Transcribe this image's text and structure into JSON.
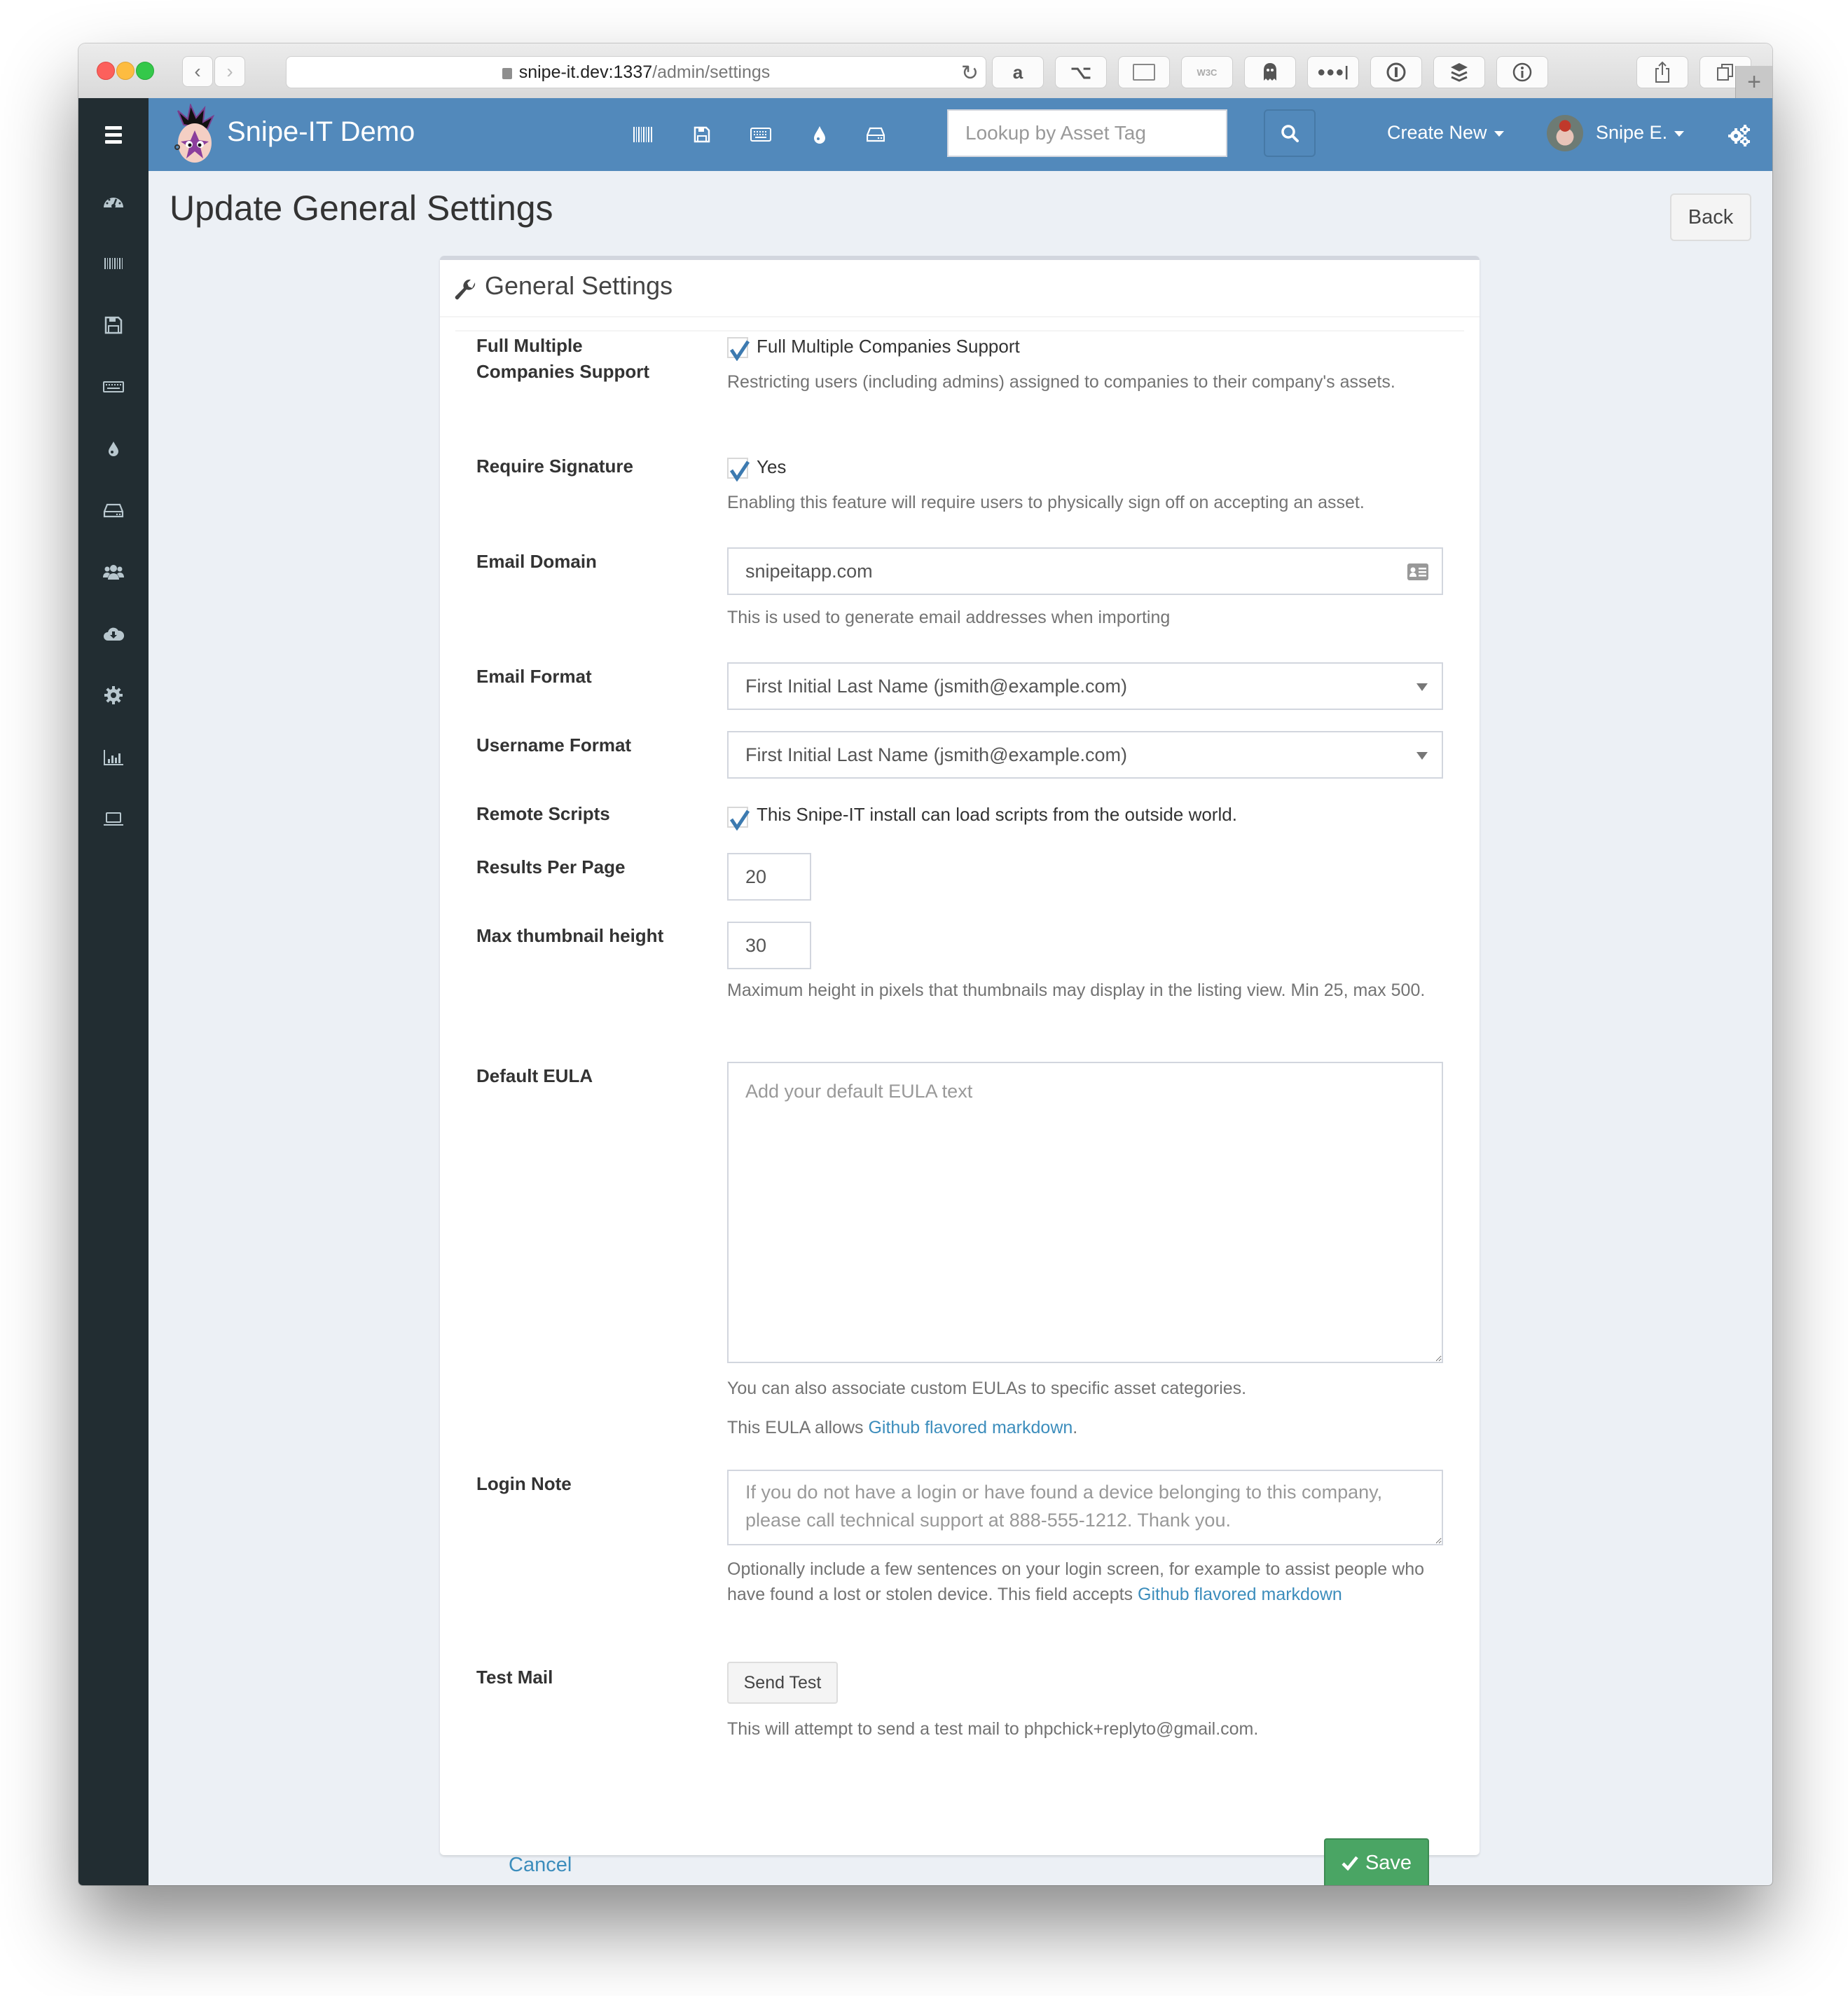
{
  "browser": {
    "url_host": "snipe-it.dev:1337",
    "url_path": "/admin/settings",
    "extensions": [
      "amazon-icon",
      "option-key-icon",
      "reader-icon",
      "w3c-validator-icon",
      "ghostery-icon",
      "lastpass-icon",
      "onepassword-icon",
      "buffer-icon",
      "info-icon"
    ],
    "w3c_label": "W3C"
  },
  "nav": {
    "brand": "Snipe-IT Demo",
    "icons": [
      "barcode-icon",
      "floppy-icon",
      "keyboard-icon",
      "tint-icon",
      "hdd-icon"
    ],
    "lookup_placeholder": "Lookup by Asset Tag",
    "create_new": "Create New",
    "user_name": "Snipe E."
  },
  "sidebar": {
    "items": [
      "dashboard-icon",
      "barcode-icon",
      "floppy-icon",
      "keyboard-icon",
      "tint-icon",
      "hdd-icon",
      "users-icon",
      "cloud-download-icon",
      "cog-icon",
      "bar-chart-icon",
      "laptop-icon"
    ]
  },
  "page": {
    "title": "Update General Settings",
    "back_label": "Back"
  },
  "panel": {
    "title": "General Settings"
  },
  "form": {
    "full_multiple_companies": {
      "label_line1": "Full Multiple",
      "label_line2": "Companies Support",
      "checkbox_label": "Full Multiple Companies Support",
      "checked": true,
      "help": "Restricting users (including admins) assigned to companies to their company's assets."
    },
    "require_signature": {
      "label": "Require Signature",
      "checkbox_label": "Yes",
      "checked": true,
      "help": "Enabling this feature will require users to physically sign off on accepting an asset."
    },
    "email_domain": {
      "label": "Email Domain",
      "value": "snipeitapp.com",
      "help": "This is used to generate email addresses when importing"
    },
    "email_format": {
      "label": "Email Format",
      "selected": "First Initial Last Name (jsmith@example.com)"
    },
    "username_format": {
      "label": "Username Format",
      "selected": "First Initial Last Name (jsmith@example.com)"
    },
    "remote_scripts": {
      "label": "Remote Scripts",
      "checkbox_label": "This Snipe-IT install can load scripts from the outside world.",
      "checked": true
    },
    "results_per_page": {
      "label": "Results Per Page",
      "value": "20"
    },
    "max_thumbnail_height": {
      "label": "Max thumbnail height",
      "value": "30",
      "help": "Maximum height in pixels that thumbnails may display in the listing view. Min 25, max 500."
    },
    "default_eula": {
      "label": "Default EULA",
      "placeholder": "Add your default EULA text",
      "help1": "You can also associate custom EULAs to specific asset categories.",
      "help2_prefix": "This EULA allows ",
      "help2_link": "Github flavored markdown",
      "help2_suffix": "."
    },
    "login_note": {
      "label": "Login Note",
      "placeholder": "If you do not have a login or have found a device belonging to this company, please call technical support at 888-555-1212. Thank you.",
      "help_prefix": "Optionally include a few sentences on your login screen, for example to assist people who have found a lost or stolen device. This field accepts ",
      "help_link": "Github flavored markdown"
    },
    "test_mail": {
      "label": "Test Mail",
      "button": "Send Test",
      "help": "This will attempt to send a test mail to phpchick+replyto@gmail.com."
    }
  },
  "footer": {
    "cancel": "Cancel",
    "save": "Save"
  },
  "colors": {
    "nav": "#5289bb",
    "sidebar": "#222d32",
    "content_bg": "#ecf0f5",
    "link": "#3c8dbc",
    "save": "#4aa564",
    "check": "#3c7ab0"
  }
}
